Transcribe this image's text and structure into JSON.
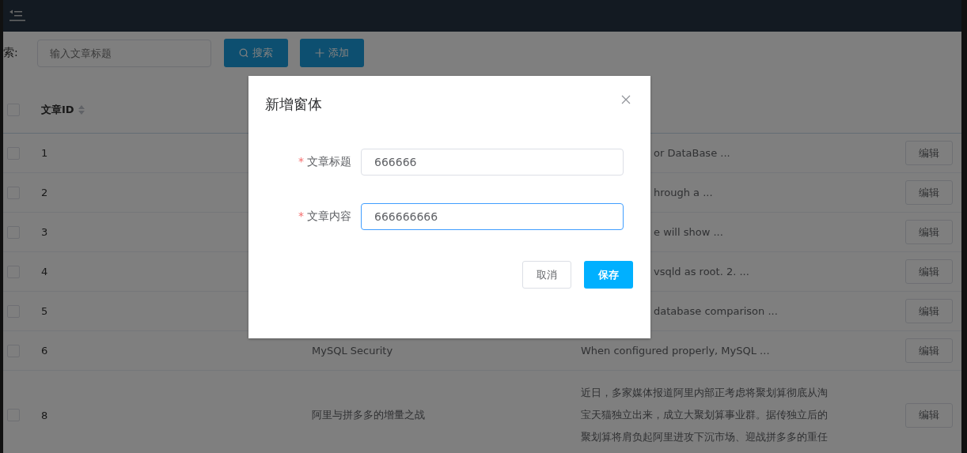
{
  "toolbar": {
    "search_label": "索:",
    "search": {
      "placeholder": "输入文章标题"
    },
    "buttons": [
      {
        "kind": "search",
        "label": "搜索"
      },
      {
        "kind": "add",
        "label": "添加"
      }
    ]
  },
  "table": {
    "select_all": {
      "checked": false
    },
    "columns": [
      {
        "label": "文章ID"
      }
    ],
    "rows": [
      {
        "checked": false,
        "id": "1",
        "content": "or DataBase ...",
        "action": "编辑"
      },
      {
        "checked": false,
        "id": "2",
        "content": "hrough a ...",
        "action": "编辑"
      },
      {
        "checked": false,
        "id": "3",
        "content": "e will show ...",
        "action": "编辑"
      },
      {
        "checked": false,
        "id": "4",
        "content": "vsqld as root. 2. ...",
        "action": "编辑"
      },
      {
        "checked": false,
        "id": "5",
        "content": "database comparison ...",
        "action": "编辑"
      },
      {
        "checked": false,
        "id": "6",
        "title": "MySQL Security",
        "content": "When configured properly, MySQL ...",
        "action": "编辑"
      },
      {
        "checked": false,
        "id": "8",
        "title": "阿里与拼多多的增量之战",
        "content": "近日，多家媒体报道阿里内部正考虑将聚划算彻底从淘宝天猫独立出来，成立大聚划算事业群。据传独立后的聚划算将肩负起阿里进攻下沉市场、迎战拼多多的重任",
        "action": "编辑"
      }
    ]
  },
  "dialog": {
    "title": "新增窗体",
    "fields": [
      {
        "label": "文章标题",
        "required_mark": "*",
        "value": "666666",
        "focused": false
      },
      {
        "label": "文章内容",
        "required_mark": "*",
        "value": "666666666",
        "focused": true
      }
    ],
    "buttons": [
      {
        "kind": "secondary",
        "label": "取消"
      },
      {
        "kind": "primary",
        "label": "保存"
      }
    ]
  }
}
